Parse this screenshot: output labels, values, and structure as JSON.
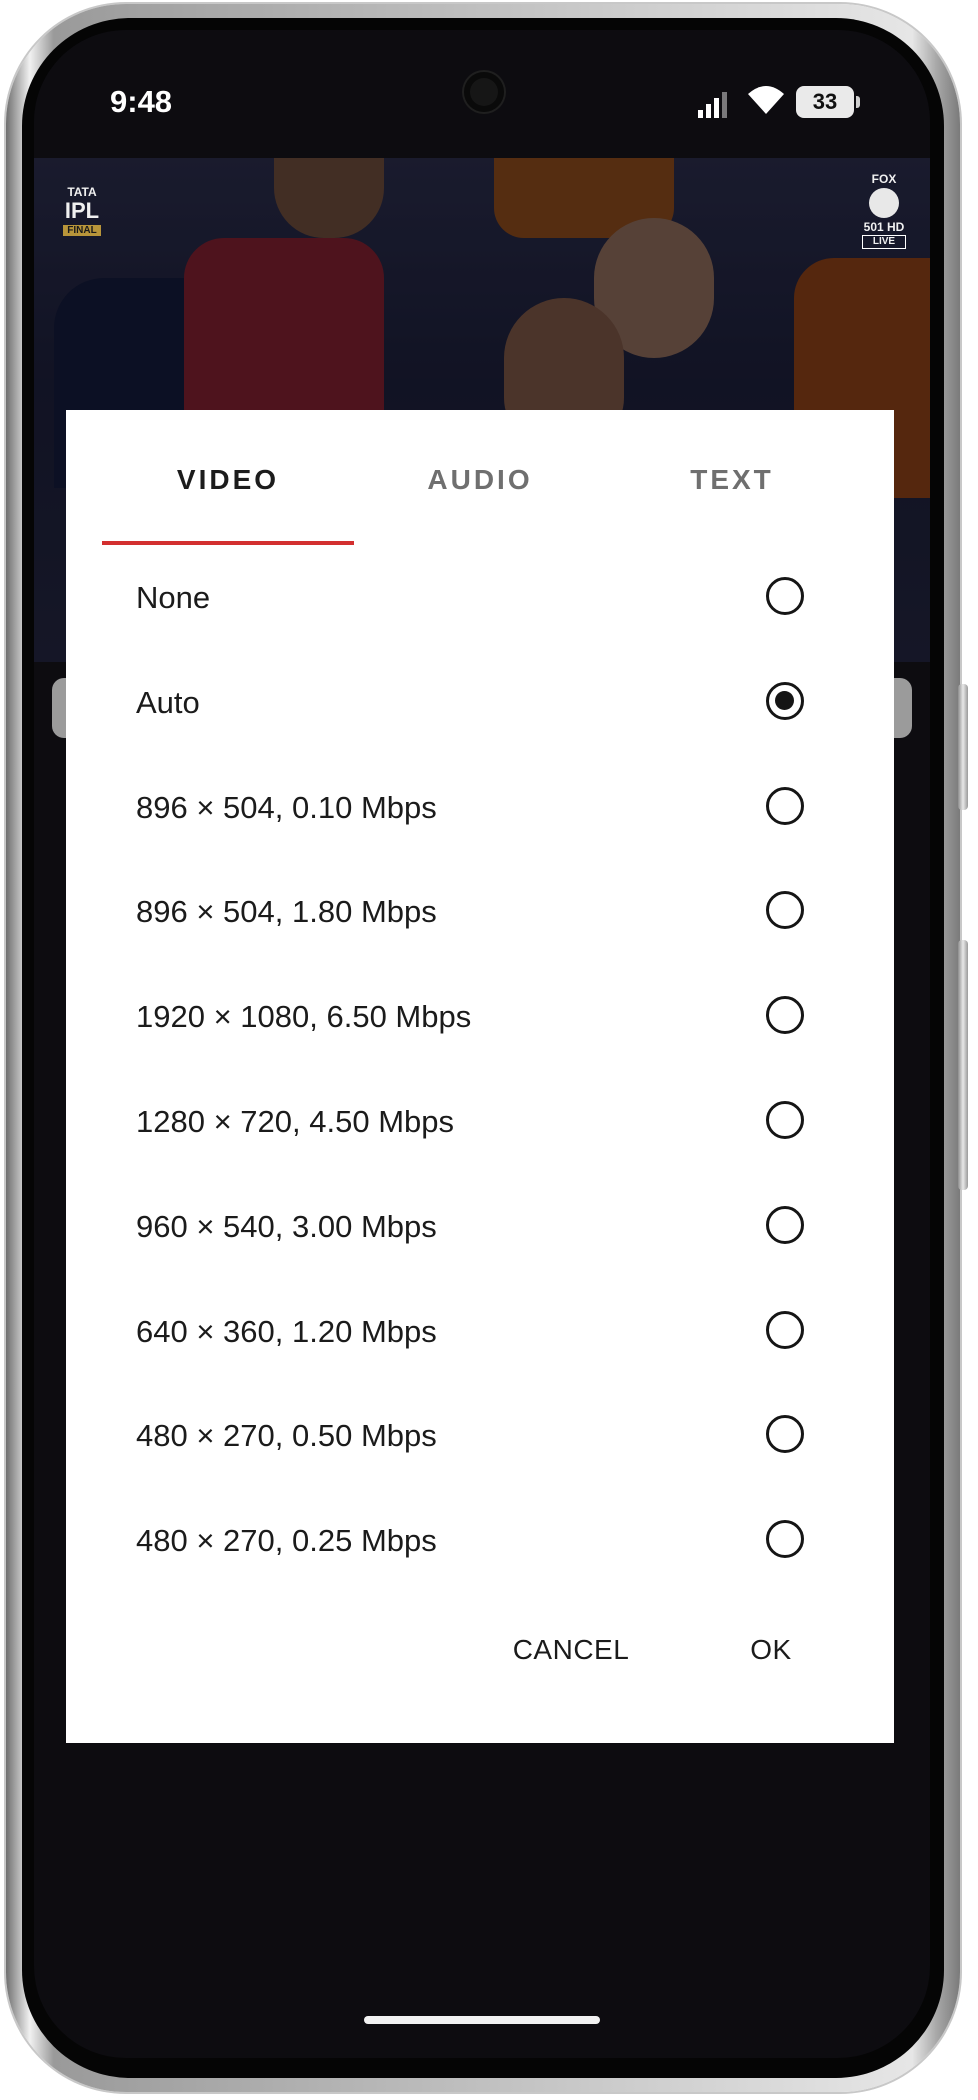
{
  "status_bar": {
    "time": "9:48",
    "battery_level": "33",
    "icons": [
      "camera-hole",
      "signal-icon",
      "wifi-icon",
      "battery-icon"
    ]
  },
  "video": {
    "left_logo": {
      "line1": "TATA",
      "line2": "IPL",
      "tag": "FINAL"
    },
    "right_logo": {
      "line1": "FOX",
      "line2": "501 HD",
      "tag": "LIVE"
    }
  },
  "dialog": {
    "tabs": [
      {
        "label": "VIDEO",
        "active": true
      },
      {
        "label": "AUDIO",
        "active": false
      },
      {
        "label": "TEXT",
        "active": false
      }
    ],
    "accent_color": "#d32f2f",
    "options": [
      {
        "label": "None",
        "selected": false
      },
      {
        "label": "Auto",
        "selected": true
      },
      {
        "label": "896 × 504, 0.10 Mbps",
        "selected": false
      },
      {
        "label": "896 × 504, 1.80 Mbps",
        "selected": false
      },
      {
        "label": "1920 × 1080, 6.50 Mbps",
        "selected": false
      },
      {
        "label": "1280 × 720, 4.50 Mbps",
        "selected": false
      },
      {
        "label": "960 × 540, 3.00 Mbps",
        "selected": false
      },
      {
        "label": "640 × 360, 1.20 Mbps",
        "selected": false
      },
      {
        "label": "480 × 270, 0.50 Mbps",
        "selected": false
      },
      {
        "label": "480 × 270, 0.25 Mbps",
        "selected": false
      }
    ],
    "cancel_label": "CANCEL",
    "ok_label": "OK"
  }
}
